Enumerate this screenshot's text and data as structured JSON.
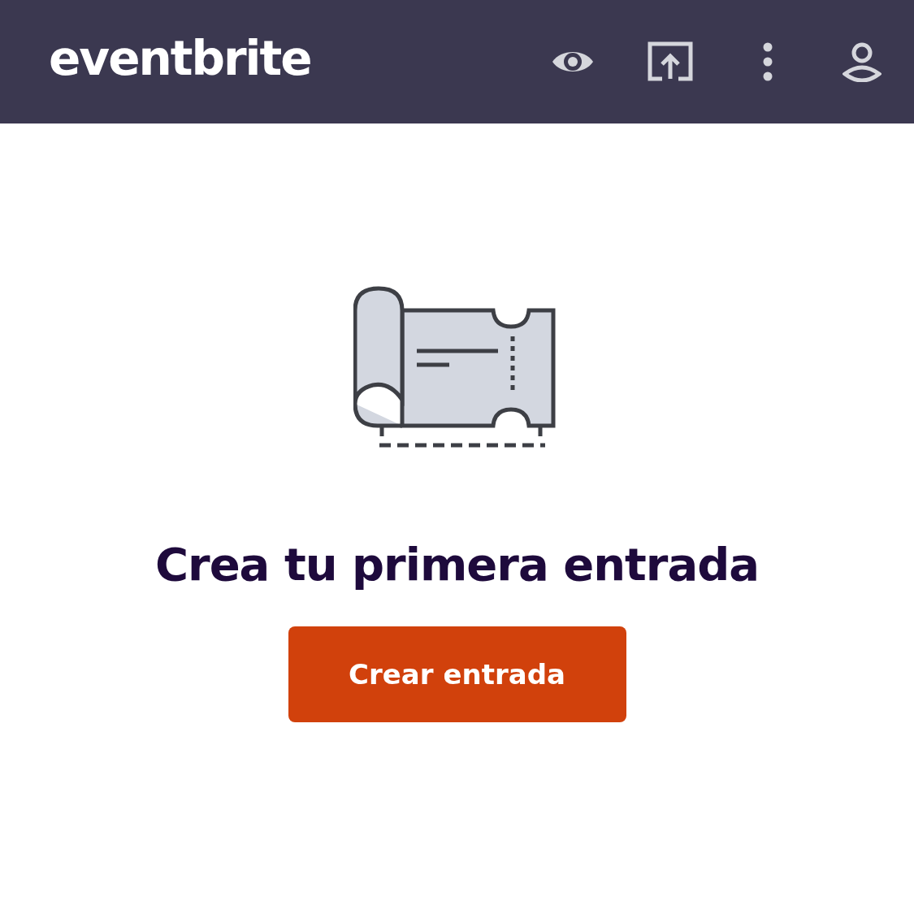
{
  "header": {
    "logo": "eventbrite"
  },
  "empty_state": {
    "title": "Crea tu primera entrada",
    "button": "Crear entrada"
  }
}
